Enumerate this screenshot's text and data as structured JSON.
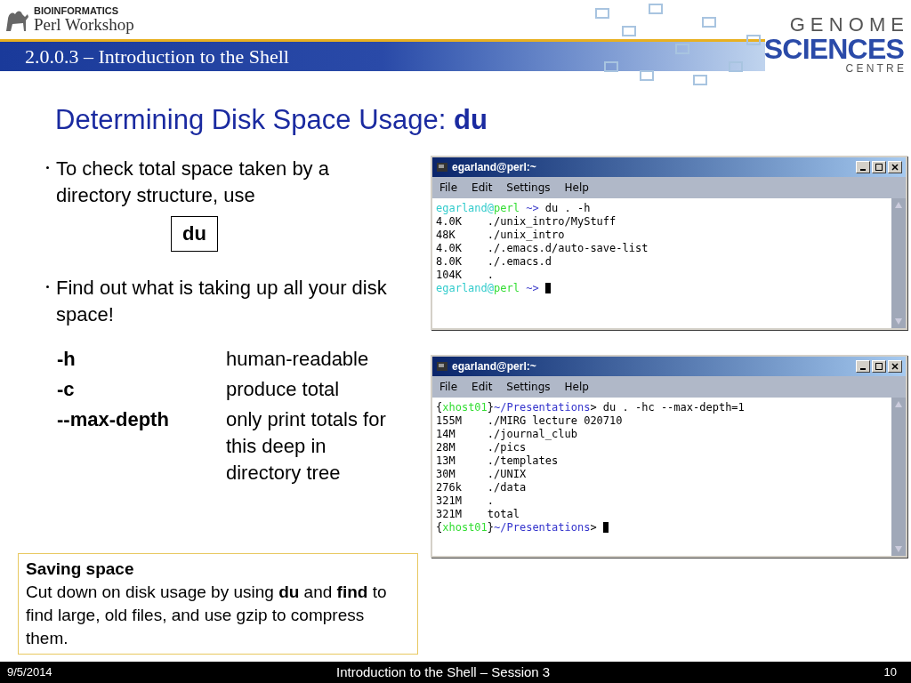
{
  "header": {
    "logo_top": "BIOINFORMATICS",
    "logo_bottom": "Perl Workshop",
    "section": "2.0.0.3 – Introduction to the Shell",
    "brand_top": "G E N O M E",
    "brand_middle": "SCIENCES",
    "brand_bottom": "C E N T R E"
  },
  "title": {
    "text": "Determining Disk Space Usage: ",
    "command": "du"
  },
  "bullets": [
    {
      "text": "To check total space taken by a directory structure, use",
      "command": "du"
    },
    {
      "text": "Find out what is taking up all your disk space!"
    }
  ],
  "options": [
    {
      "flag": "-h",
      "description": "human-readable"
    },
    {
      "flag": "-c",
      "description": "produce total"
    },
    {
      "flag": "--max-depth",
      "description": "only print totals for this deep in directory tree"
    }
  ],
  "callout": {
    "title": "Saving space",
    "text": "Cut down on disk usage by using **du** and **find** to find large, old files, and use gzip to compress them."
  },
  "terminals": [
    {
      "title": "egarland@perl:~",
      "menu": [
        "File",
        "Edit",
        "Settings",
        "Help"
      ],
      "lines": [
        [
          {
            "text": "egarland@",
            "color": "#33cccc"
          },
          {
            "text": "perl",
            "color": "#33dd33"
          },
          {
            "text": " ~>",
            "color": "#4444cc"
          },
          {
            "text": " du . -h"
          }
        ],
        [
          {
            "text": "4.0K    ./unix_intro/MyStuff",
            "color": "#000000"
          }
        ],
        [
          {
            "text": "48K     ./unix_intro",
            "color": "#000000"
          }
        ],
        [
          {
            "text": "4.0K    ./.emacs.d/auto-save-list",
            "color": "#000000"
          }
        ],
        [
          {
            "text": "8.0K    ./.emacs.d",
            "color": "#000000"
          }
        ],
        [
          {
            "text": "104K    .",
            "color": "#000000"
          }
        ],
        [
          {
            "text": "egarland@",
            "color": "#33cccc"
          },
          {
            "text": "perl",
            "color": "#33dd33"
          },
          {
            "text": " ~>",
            "color": "#4444cc"
          }
        ]
      ],
      "cursor": true
    },
    {
      "title": "egarland@perl:~",
      "menu": [
        "File",
        "Edit",
        "Settings",
        "Help"
      ],
      "lines": [
        [
          {
            "text": "{"
          },
          {
            "text": "xhost01",
            "color": "#33dd33"
          },
          {
            "text": "}"
          },
          {
            "text": "~/Presentations",
            "color": "#3333cc"
          },
          {
            "text": "> du . -hc --max-depth=1"
          }
        ],
        [
          {
            "text": "155M    ./MIRG lecture 020710",
            "color": "#000000"
          }
        ],
        [
          {
            "text": "14M     ./journal_club",
            "color": "#000000"
          }
        ],
        [
          {
            "text": "28M     ./pics",
            "color": "#000000"
          }
        ],
        [
          {
            "text": "13M     ./templates",
            "color": "#000000"
          }
        ],
        [
          {
            "text": "30M     ./UNIX",
            "color": "#000000"
          }
        ],
        [
          {
            "text": "276k    ./data",
            "color": "#000000"
          }
        ],
        [
          {
            "text": "321M    .",
            "color": "#000000"
          }
        ],
        [
          {
            "text": "321M    total",
            "color": "#000000"
          }
        ],
        [
          {
            "text": "{"
          },
          {
            "text": "xhost01",
            "color": "#33dd33"
          },
          {
            "text": "}"
          },
          {
            "text": "~/Presentations",
            "color": "#3333cc"
          },
          {
            "text": ">"
          }
        ]
      ],
      "cursor": true
    }
  ],
  "footer": {
    "date": "9/5/2014",
    "title": "Introduction to the Shell – Session 3",
    "page": "10"
  }
}
